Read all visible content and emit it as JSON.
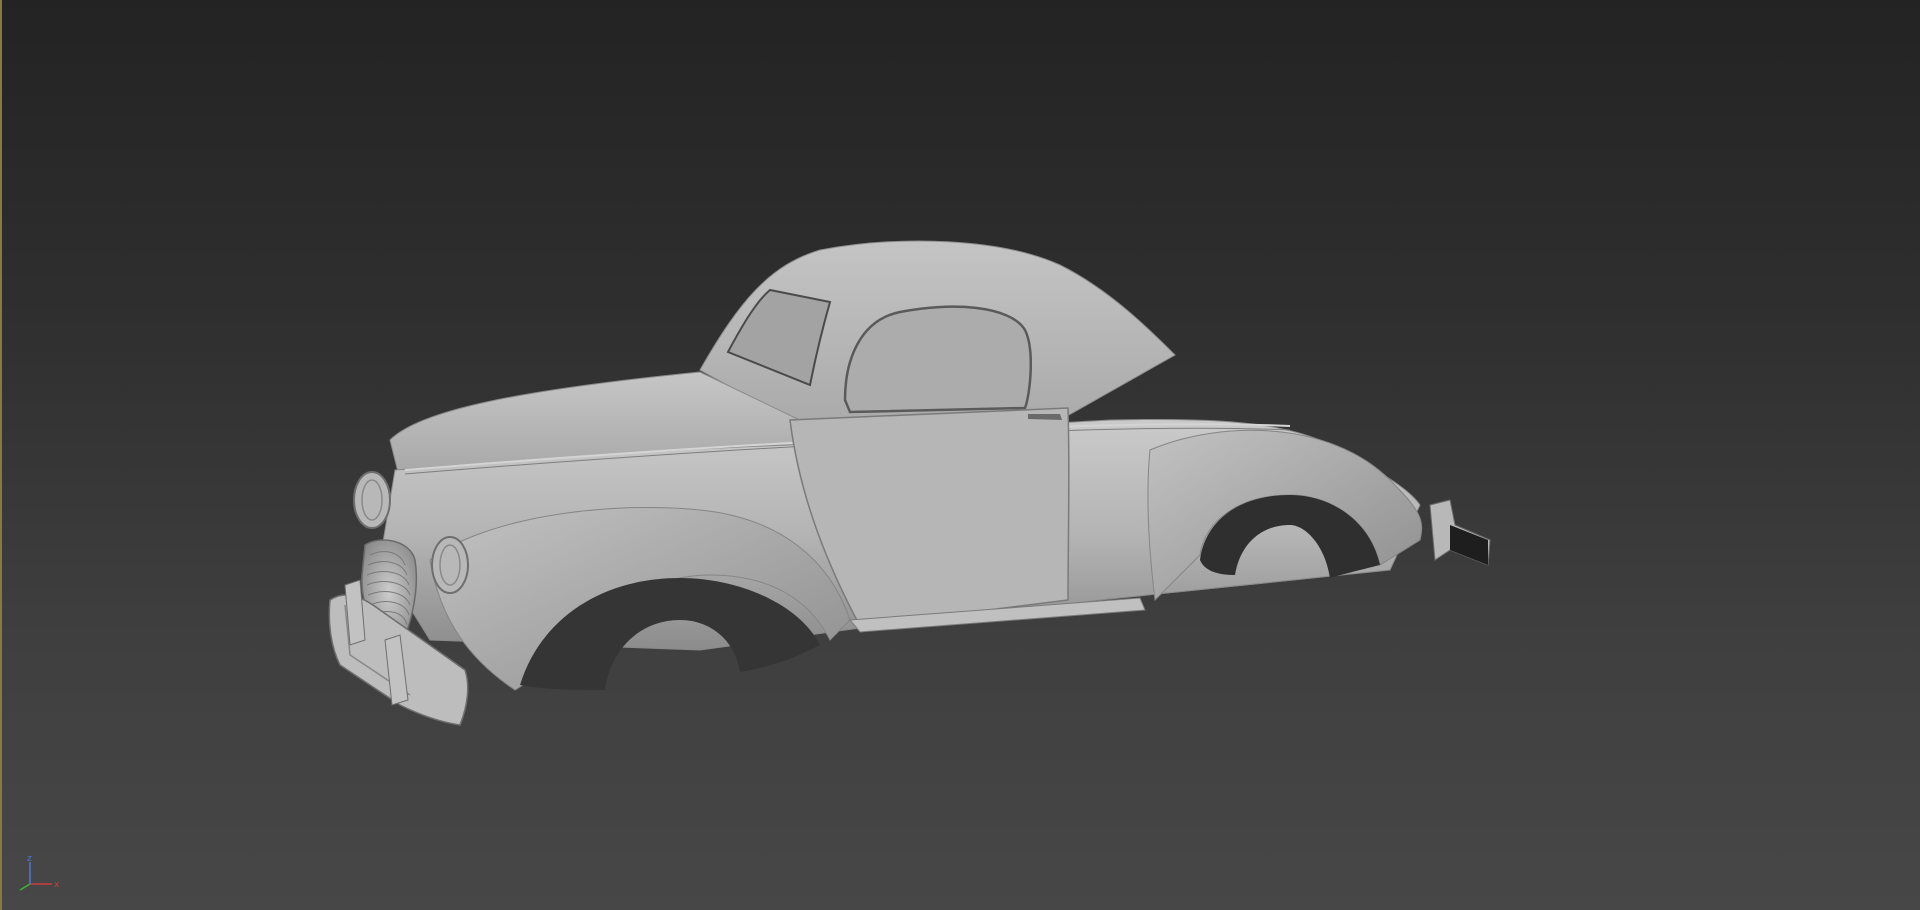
{
  "viewport": {
    "background_top": "#232323",
    "background_bottom": "#474747",
    "border_color": "#8a7a3a"
  },
  "model": {
    "surface_color": "#b4b4b4",
    "shadow_color": "#7d7d7d",
    "highlight_color": "#cfcfcf",
    "window_color": "#9a9a9a",
    "dark_part_color": "#1a1a1a"
  },
  "axis_gizmo": {
    "x_label": "x",
    "z_label": "z",
    "x_color": "#c83c3c",
    "y_color": "#3cb43c",
    "z_color": "#4a78d8"
  }
}
